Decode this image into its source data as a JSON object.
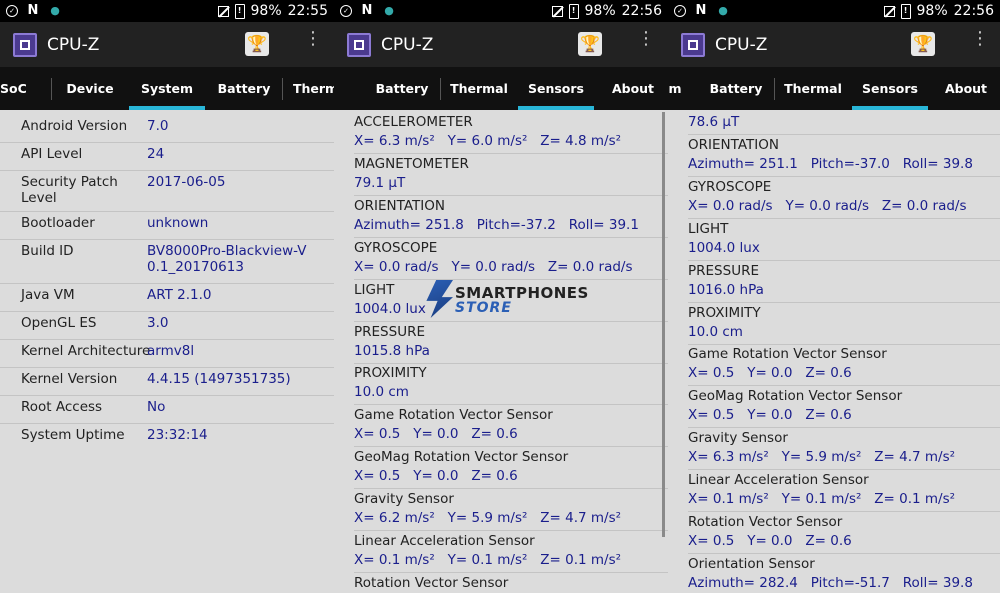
{
  "status_bar": {
    "battery": "98%",
    "times": [
      "22:55",
      "22:56",
      "22:56"
    ]
  },
  "app": {
    "title": "CPU-Z"
  },
  "panel1": {
    "tabs": [
      "SoC",
      "Device",
      "System",
      "Battery",
      "Thermm"
    ],
    "active_tab": "System",
    "rows": [
      {
        "key": "Android Version",
        "value": "7.0"
      },
      {
        "key": "API Level",
        "value": "24"
      },
      {
        "key": "Security Patch Level",
        "value": "2017-06-05"
      },
      {
        "key": "Bootloader",
        "value": "unknown"
      },
      {
        "key": "Build ID",
        "value": "BV8000Pro-Blackview-V0.1_20170613"
      },
      {
        "key": "Java VM",
        "value": "ART 2.1.0"
      },
      {
        "key": "OpenGL ES",
        "value": "3.0"
      },
      {
        "key": "Kernel Architecture",
        "value": "armv8l"
      },
      {
        "key": "Kernel Version",
        "value": "4.4.15 (1497351735)"
      },
      {
        "key": "Root Access",
        "value": "No"
      },
      {
        "key": "System Uptime",
        "value": "23:32:14"
      }
    ]
  },
  "panel2": {
    "tabs": [
      "Battery",
      "Thermal",
      "Sensors",
      "About"
    ],
    "active_tab": "Sensors",
    "sensors": [
      {
        "name": "ACCELEROMETER",
        "value": "X= 6.3 m/s²   Y= 6.0 m/s²   Z= 4.8 m/s²"
      },
      {
        "name": "MAGNETOMETER",
        "value": "79.1 µT"
      },
      {
        "name": "ORIENTATION",
        "value": "Azimuth= 251.8   Pitch=-37.2   Roll= 39.1"
      },
      {
        "name": "GYROSCOPE",
        "value": "X= 0.0 rad/s   Y= 0.0 rad/s   Z= 0.0 rad/s"
      },
      {
        "name": "LIGHT",
        "value": "1004.0 lux"
      },
      {
        "name": "PRESSURE",
        "value": "1015.8 hPa"
      },
      {
        "name": "PROXIMITY",
        "value": "10.0 cm"
      },
      {
        "name": "Game Rotation Vector Sensor",
        "value": "X= 0.5   Y= 0.0   Z= 0.6"
      },
      {
        "name": "GeoMag Rotation Vector Sensor",
        "value": "X= 0.5   Y= 0.0   Z= 0.6"
      },
      {
        "name": "Gravity Sensor",
        "value": "X= 6.2 m/s²   Y= 5.9 m/s²   Z= 4.7 m/s²"
      },
      {
        "name": "Linear Acceleration Sensor",
        "value": "X= 0.1 m/s²   Y= 0.1 m/s²   Z= 0.1 m/s²"
      },
      {
        "name": "Rotation Vector Sensor",
        "value": ""
      }
    ]
  },
  "panel3": {
    "tabs": [
      "m",
      "Battery",
      "Thermal",
      "Sensors",
      "About"
    ],
    "active_tab": "Sensors",
    "top_value": "78.6 µT",
    "sensors": [
      {
        "name": "ORIENTATION",
        "value": "Azimuth= 251.1   Pitch=-37.0   Roll= 39.8"
      },
      {
        "name": "GYROSCOPE",
        "value": "X= 0.0 rad/s   Y= 0.0 rad/s   Z= 0.0 rad/s"
      },
      {
        "name": "LIGHT",
        "value": "1004.0 lux"
      },
      {
        "name": "PRESSURE",
        "value": "1016.0 hPa"
      },
      {
        "name": "PROXIMITY",
        "value": "10.0 cm"
      },
      {
        "name": "Game Rotation Vector Sensor",
        "value": "X= 0.5   Y= 0.0   Z= 0.6"
      },
      {
        "name": "GeoMag Rotation Vector Sensor",
        "value": "X= 0.5   Y= 0.0   Z= 0.6"
      },
      {
        "name": "Gravity Sensor",
        "value": "X= 6.3 m/s²   Y= 5.9 m/s²   Z= 4.7 m/s²"
      },
      {
        "name": "Linear Acceleration Sensor",
        "value": "X= 0.1 m/s²   Y= 0.1 m/s²   Z= 0.1 m/s²"
      },
      {
        "name": "Rotation Vector Sensor",
        "value": "X= 0.5   Y= 0.0   Z= 0.6"
      },
      {
        "name": "Orientation Sensor",
        "value": "Azimuth= 282.4   Pitch=-51.7   Roll= 39.8"
      }
    ]
  },
  "watermark": {
    "line1": "SMARTPHONES",
    "line2": "STORE"
  },
  "colors": {
    "accent": "#29b6d8",
    "value_text": "#1a1e8c",
    "appbar": "#222222",
    "tabbar": "#111111"
  }
}
